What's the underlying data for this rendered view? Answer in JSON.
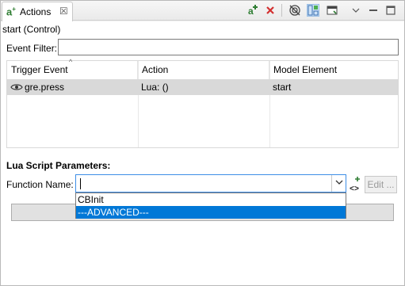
{
  "tab": {
    "icon": "a",
    "icon_sup": "+",
    "label": "Actions",
    "close": "☒"
  },
  "toolbar": {
    "add_icon": "add-action-icon",
    "delete_icon": "delete-icon",
    "filter_icon": "filter-icon",
    "layout_icon": "layout-icon",
    "window_icon": "window-icon",
    "view_menu_icon": "view-menu-icon",
    "minimize_icon": "minimize-icon",
    "maximize_icon": "maximize-icon"
  },
  "context_label": "start (Control)",
  "filter": {
    "label": "Event Filter:",
    "value": ""
  },
  "table": {
    "columns": [
      "Trigger Event",
      "Action",
      "Model Element"
    ],
    "rows": [
      {
        "trigger": "gre.press",
        "action": "Lua: ()",
        "element": "start"
      }
    ]
  },
  "lua": {
    "section_title": "Lua Script Parameters:",
    "function_label": "Function Name:",
    "function_value": "",
    "options": [
      "CBInit",
      "---ADVANCED---"
    ],
    "highlighted_option": "---ADVANCED---",
    "edit_label": "Edit ..."
  },
  "colors": {
    "selection": "#0078d7",
    "row_selected": "#d9d9d9",
    "accent_add": "#2e7d32",
    "delete": "#d32f2f"
  }
}
